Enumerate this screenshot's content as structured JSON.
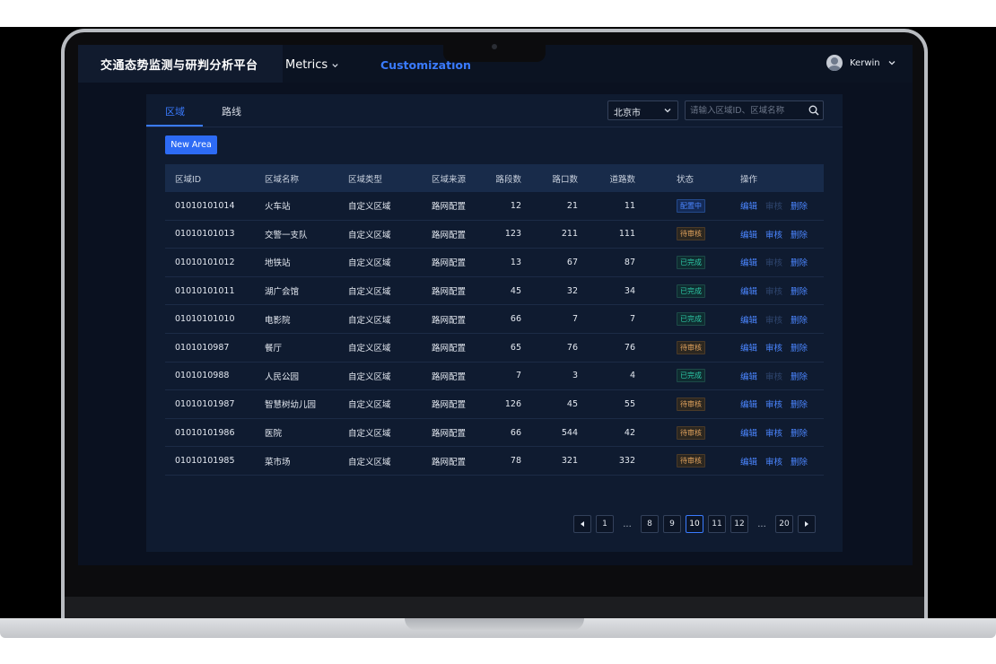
{
  "header": {
    "app_title": "交通态势监测与研判分析平台",
    "nav": [
      {
        "label": "Metrics",
        "has_dropdown": true
      },
      {
        "label": "Customization",
        "active": true
      }
    ],
    "user_name": "Kerwin"
  },
  "tabs": [
    {
      "label": "区域",
      "active": true
    },
    {
      "label": "路线",
      "active": false
    }
  ],
  "filters": {
    "city": "北京市",
    "search_placeholder": "请输入区域ID、区域名称"
  },
  "new_area_label": "New Area",
  "table": {
    "columns": [
      "区域ID",
      "区域名称",
      "区域类型",
      "区域来源",
      "路段数",
      "路口数",
      "道路数",
      "状态",
      "操作"
    ],
    "rows": [
      {
        "id": "01010101014",
        "name": "火车站",
        "type": "自定义区域",
        "source": "路网配置",
        "segments": "12",
        "crossings": "21",
        "roads": "11",
        "status": "配置中",
        "status_kind": "config",
        "review_enabled": false
      },
      {
        "id": "01010101013",
        "name": "交警一支队",
        "type": "自定义区域",
        "source": "路网配置",
        "segments": "123",
        "crossings": "211",
        "roads": "111",
        "status": "待审核",
        "status_kind": "pending",
        "review_enabled": true
      },
      {
        "id": "01010101012",
        "name": "地铁站",
        "type": "自定义区域",
        "source": "路网配置",
        "segments": "13",
        "crossings": "67",
        "roads": "87",
        "status": "已完成",
        "status_kind": "done",
        "review_enabled": false
      },
      {
        "id": "01010101011",
        "name": "湖广会馆",
        "type": "自定义区域",
        "source": "路网配置",
        "segments": "45",
        "crossings": "32",
        "roads": "34",
        "status": "已完成",
        "status_kind": "done",
        "review_enabled": false
      },
      {
        "id": "01010101010",
        "name": "电影院",
        "type": "自定义区域",
        "source": "路网配置",
        "segments": "66",
        "crossings": "7",
        "roads": "7",
        "status": "已完成",
        "status_kind": "done",
        "review_enabled": false
      },
      {
        "id": "0101010987",
        "name": "餐厅",
        "type": "自定义区域",
        "source": "路网配置",
        "segments": "65",
        "crossings": "76",
        "roads": "76",
        "status": "待审核",
        "status_kind": "pending",
        "review_enabled": true
      },
      {
        "id": "0101010988",
        "name": "人民公园",
        "type": "自定义区域",
        "source": "路网配置",
        "segments": "7",
        "crossings": "3",
        "roads": "4",
        "status": "已完成",
        "status_kind": "done",
        "review_enabled": false
      },
      {
        "id": "01010101987",
        "name": "智慧树幼儿园",
        "type": "自定义区域",
        "source": "路网配置",
        "segments": "126",
        "crossings": "45",
        "roads": "55",
        "status": "待审核",
        "status_kind": "pending",
        "review_enabled": true
      },
      {
        "id": "01010101986",
        "name": "医院",
        "type": "自定义区域",
        "source": "路网配置",
        "segments": "66",
        "crossings": "544",
        "roads": "42",
        "status": "待审核",
        "status_kind": "pending",
        "review_enabled": true
      },
      {
        "id": "01010101985",
        "name": "菜市场",
        "type": "自定义区域",
        "source": "路网配置",
        "segments": "78",
        "crossings": "321",
        "roads": "332",
        "status": "待审核",
        "status_kind": "pending",
        "review_enabled": true
      }
    ],
    "ops": {
      "edit": "编辑",
      "review": "审核",
      "delete": "删除"
    }
  },
  "pagination": {
    "items": [
      "1",
      "...",
      "8",
      "9",
      "10",
      "11",
      "12",
      "...",
      "20"
    ],
    "current": "10"
  },
  "colors": {
    "accent": "#3a7bff",
    "screen_bg": "#0a1120",
    "panel_bg": "#0f1b30",
    "status_config": "#4b86ff",
    "status_pending": "#e0a25d",
    "status_done": "#2cc4a4"
  }
}
